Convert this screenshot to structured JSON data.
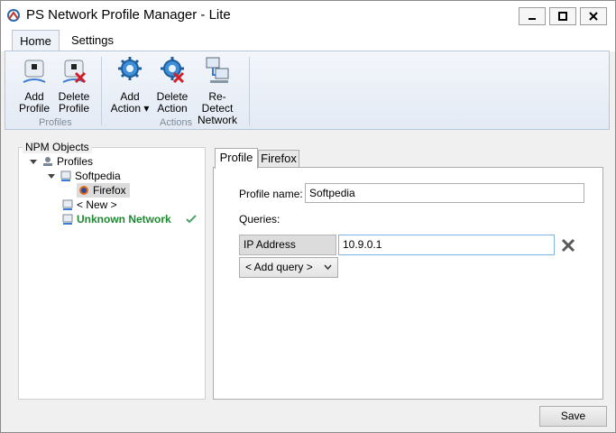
{
  "window": {
    "title": "PS Network Profile Manager - Lite",
    "controls": {
      "minimize": "minimize-icon",
      "maximize": "maximize-icon",
      "close": "close-icon"
    }
  },
  "ribbon": {
    "tabs": [
      "Home",
      "Settings"
    ],
    "active_tab": "Home",
    "groups": [
      {
        "label": "Profiles",
        "buttons": [
          {
            "line1": "Add",
            "line2": "Profile",
            "icon": "add-profile-icon"
          },
          {
            "line1": "Delete",
            "line2": "Profile",
            "icon": "delete-profile-icon"
          }
        ]
      },
      {
        "label": "Actions",
        "buttons": [
          {
            "line1": "Add",
            "line2": "Action ▾",
            "icon": "add-action-icon"
          },
          {
            "line1": "Delete",
            "line2": "Action",
            "icon": "delete-action-icon"
          },
          {
            "line1": "Re-Detect",
            "line2": "Network",
            "icon": "redetect-network-icon"
          }
        ]
      }
    ]
  },
  "tree": {
    "legend": "NPM Objects",
    "nodes": [
      "Profiles",
      "Softpedia",
      "Firefox",
      "< New >",
      "Unknown Network"
    ],
    "selected": "Firefox"
  },
  "content": {
    "tabs": [
      "Profile",
      "Firefox"
    ],
    "active_tab": "Profile",
    "profile_name_label": "Profile name:",
    "profile_name_value": "Softpedia",
    "queries_label": "Queries:",
    "query": {
      "type": "IP Address",
      "value": "10.9.0.1"
    },
    "add_query_label": "< Add query >"
  },
  "footer": {
    "save_label": "Save"
  },
  "colors": {
    "accent": "#1c8a2e",
    "ribbon_border": "#b7c6d9",
    "focus_border": "#7eb4ea"
  }
}
